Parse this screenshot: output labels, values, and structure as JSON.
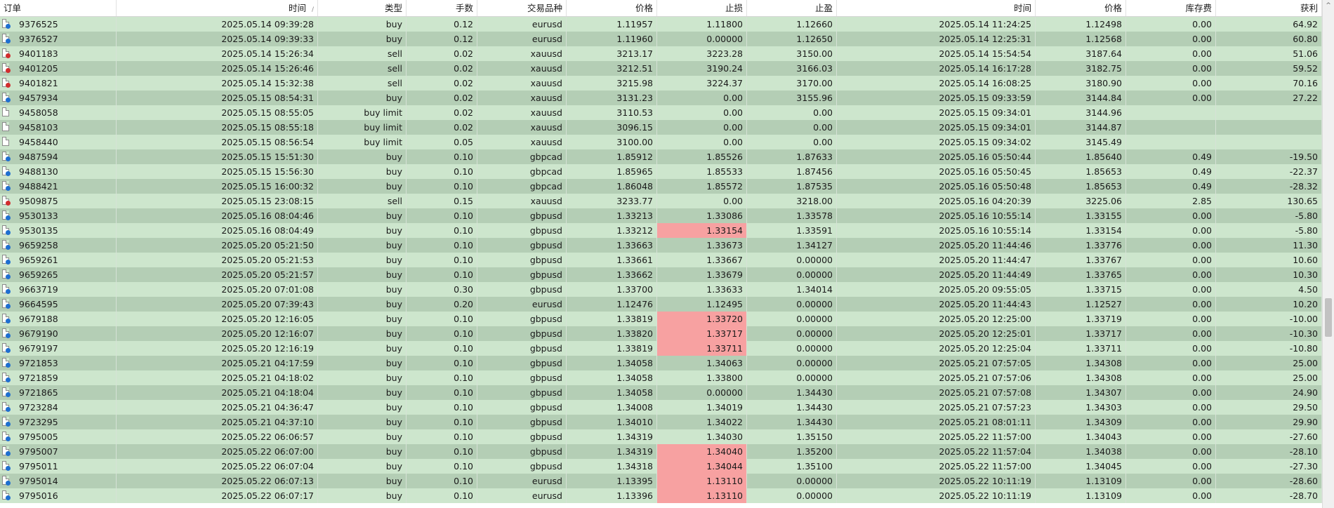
{
  "columns": [
    {
      "key": "order",
      "label": "订单",
      "sort": ""
    },
    {
      "key": "time",
      "label": "时间",
      "sort": "/"
    },
    {
      "key": "type",
      "label": "类型",
      "sort": ""
    },
    {
      "key": "volume",
      "label": "手数",
      "sort": ""
    },
    {
      "key": "symbol",
      "label": "交易品种",
      "sort": ""
    },
    {
      "key": "price",
      "label": "价格",
      "sort": ""
    },
    {
      "key": "sl",
      "label": "止损",
      "sort": ""
    },
    {
      "key": "tp",
      "label": "止盈",
      "sort": ""
    },
    {
      "key": "close_time",
      "label": "时间",
      "sort": ""
    },
    {
      "key": "close_price",
      "label": "价格",
      "sort": ""
    },
    {
      "key": "swap",
      "label": "库存费",
      "sort": ""
    },
    {
      "key": "profit",
      "label": "获利",
      "sort": ""
    }
  ],
  "colors": {
    "row_even": "#cde6cd",
    "row_odd": "#b4ceb5",
    "stop_hit": "#f7a1a1",
    "buy_icon": "#1e6fd0",
    "sell_icon": "#d12d2d"
  },
  "rows": [
    {
      "order": "9376525",
      "time": "2025.05.14 09:39:28",
      "type": "buy",
      "volume": "0.12",
      "symbol": "eurusd",
      "price": "1.11957",
      "sl": "1.11800",
      "tp": "1.12660",
      "close_time": "2025.05.14 11:24:25",
      "close_price": "1.12498",
      "swap": "0.00",
      "profit": "64.92",
      "icon": "buy-order-icon",
      "sl_hit": false
    },
    {
      "order": "9376527",
      "time": "2025.05.14 09:39:33",
      "type": "buy",
      "volume": "0.12",
      "symbol": "eurusd",
      "price": "1.11960",
      "sl": "0.00000",
      "tp": "1.12650",
      "close_time": "2025.05.14 12:25:31",
      "close_price": "1.12568",
      "swap": "0.00",
      "profit": "60.80",
      "icon": "buy-order-icon",
      "sl_hit": false
    },
    {
      "order": "9401183",
      "time": "2025.05.14 15:26:34",
      "type": "sell",
      "volume": "0.02",
      "symbol": "xauusd",
      "price": "3213.17",
      "sl": "3223.28",
      "tp": "3150.00",
      "close_time": "2025.05.14 15:54:54",
      "close_price": "3187.64",
      "swap": "0.00",
      "profit": "51.06",
      "icon": "sell-order-icon",
      "sl_hit": false
    },
    {
      "order": "9401205",
      "time": "2025.05.14 15:26:46",
      "type": "sell",
      "volume": "0.02",
      "symbol": "xauusd",
      "price": "3212.51",
      "sl": "3190.24",
      "tp": "3166.03",
      "close_time": "2025.05.14 16:17:28",
      "close_price": "3182.75",
      "swap": "0.00",
      "profit": "59.52",
      "icon": "sell-order-icon",
      "sl_hit": false
    },
    {
      "order": "9401821",
      "time": "2025.05.14 15:32:38",
      "type": "sell",
      "volume": "0.02",
      "symbol": "xauusd",
      "price": "3215.98",
      "sl": "3224.37",
      "tp": "3170.00",
      "close_time": "2025.05.14 16:08:25",
      "close_price": "3180.90",
      "swap": "0.00",
      "profit": "70.16",
      "icon": "sell-order-icon",
      "sl_hit": false
    },
    {
      "order": "9457934",
      "time": "2025.05.15 08:54:31",
      "type": "buy",
      "volume": "0.02",
      "symbol": "xauusd",
      "price": "3131.23",
      "sl": "0.00",
      "tp": "3155.96",
      "close_time": "2025.05.15 09:33:59",
      "close_price": "3144.84",
      "swap": "0.00",
      "profit": "27.22",
      "icon": "buy-order-icon",
      "sl_hit": false
    },
    {
      "order": "9458058",
      "time": "2025.05.15 08:55:05",
      "type": "buy limit",
      "volume": "0.02",
      "symbol": "xauusd",
      "price": "3110.53",
      "sl": "0.00",
      "tp": "0.00",
      "close_time": "2025.05.15 09:34:01",
      "close_price": "3144.96",
      "swap": "",
      "profit": "",
      "icon": "pending-order-icon",
      "sl_hit": false
    },
    {
      "order": "9458103",
      "time": "2025.05.15 08:55:18",
      "type": "buy limit",
      "volume": "0.02",
      "symbol": "xauusd",
      "price": "3096.15",
      "sl": "0.00",
      "tp": "0.00",
      "close_time": "2025.05.15 09:34:01",
      "close_price": "3144.87",
      "swap": "",
      "profit": "",
      "icon": "pending-order-icon",
      "sl_hit": false
    },
    {
      "order": "9458440",
      "time": "2025.05.15 08:56:54",
      "type": "buy limit",
      "volume": "0.05",
      "symbol": "xauusd",
      "price": "3100.00",
      "sl": "0.00",
      "tp": "0.00",
      "close_time": "2025.05.15 09:34:02",
      "close_price": "3145.49",
      "swap": "",
      "profit": "",
      "icon": "pending-order-icon",
      "sl_hit": false
    },
    {
      "order": "9487594",
      "time": "2025.05.15 15:51:30",
      "type": "buy",
      "volume": "0.10",
      "symbol": "gbpcad",
      "price": "1.85912",
      "sl": "1.85526",
      "tp": "1.87633",
      "close_time": "2025.05.16 05:50:44",
      "close_price": "1.85640",
      "swap": "0.49",
      "profit": "-19.50",
      "icon": "buy-order-icon",
      "sl_hit": false
    },
    {
      "order": "9488130",
      "time": "2025.05.15 15:56:30",
      "type": "buy",
      "volume": "0.10",
      "symbol": "gbpcad",
      "price": "1.85965",
      "sl": "1.85533",
      "tp": "1.87456",
      "close_time": "2025.05.16 05:50:45",
      "close_price": "1.85653",
      "swap": "0.49",
      "profit": "-22.37",
      "icon": "buy-order-icon",
      "sl_hit": false
    },
    {
      "order": "9488421",
      "time": "2025.05.15 16:00:32",
      "type": "buy",
      "volume": "0.10",
      "symbol": "gbpcad",
      "price": "1.86048",
      "sl": "1.85572",
      "tp": "1.87535",
      "close_time": "2025.05.16 05:50:48",
      "close_price": "1.85653",
      "swap": "0.49",
      "profit": "-28.32",
      "icon": "buy-order-icon",
      "sl_hit": false
    },
    {
      "order": "9509875",
      "time": "2025.05.15 23:08:15",
      "type": "sell",
      "volume": "0.15",
      "symbol": "xauusd",
      "price": "3233.77",
      "sl": "0.00",
      "tp": "3218.00",
      "close_time": "2025.05.16 04:20:39",
      "close_price": "3225.06",
      "swap": "2.85",
      "profit": "130.65",
      "icon": "sell-order-icon",
      "sl_hit": false
    },
    {
      "order": "9530133",
      "time": "2025.05.16 08:04:46",
      "type": "buy",
      "volume": "0.10",
      "symbol": "gbpusd",
      "price": "1.33213",
      "sl": "1.33086",
      "tp": "1.33578",
      "close_time": "2025.05.16 10:55:14",
      "close_price": "1.33155",
      "swap": "0.00",
      "profit": "-5.80",
      "icon": "buy-order-icon",
      "sl_hit": false
    },
    {
      "order": "9530135",
      "time": "2025.05.16 08:04:49",
      "type": "buy",
      "volume": "0.10",
      "symbol": "gbpusd",
      "price": "1.33212",
      "sl": "1.33154",
      "tp": "1.33591",
      "close_time": "2025.05.16 10:55:14",
      "close_price": "1.33154",
      "swap": "0.00",
      "profit": "-5.80",
      "icon": "buy-order-icon",
      "sl_hit": true
    },
    {
      "order": "9659258",
      "time": "2025.05.20 05:21:50",
      "type": "buy",
      "volume": "0.10",
      "symbol": "gbpusd",
      "price": "1.33663",
      "sl": "1.33673",
      "tp": "1.34127",
      "close_time": "2025.05.20 11:44:46",
      "close_price": "1.33776",
      "swap": "0.00",
      "profit": "11.30",
      "icon": "buy-order-icon",
      "sl_hit": false
    },
    {
      "order": "9659261",
      "time": "2025.05.20 05:21:53",
      "type": "buy",
      "volume": "0.10",
      "symbol": "gbpusd",
      "price": "1.33661",
      "sl": "1.33667",
      "tp": "0.00000",
      "close_time": "2025.05.20 11:44:47",
      "close_price": "1.33767",
      "swap": "0.00",
      "profit": "10.60",
      "icon": "buy-order-icon",
      "sl_hit": false
    },
    {
      "order": "9659265",
      "time": "2025.05.20 05:21:57",
      "type": "buy",
      "volume": "0.10",
      "symbol": "gbpusd",
      "price": "1.33662",
      "sl": "1.33679",
      "tp": "0.00000",
      "close_time": "2025.05.20 11:44:49",
      "close_price": "1.33765",
      "swap": "0.00",
      "profit": "10.30",
      "icon": "buy-order-icon",
      "sl_hit": false
    },
    {
      "order": "9663719",
      "time": "2025.05.20 07:01:08",
      "type": "buy",
      "volume": "0.30",
      "symbol": "gbpusd",
      "price": "1.33700",
      "sl": "1.33633",
      "tp": "1.34014",
      "close_time": "2025.05.20 09:55:05",
      "close_price": "1.33715",
      "swap": "0.00",
      "profit": "4.50",
      "icon": "buy-order-icon",
      "sl_hit": false
    },
    {
      "order": "9664595",
      "time": "2025.05.20 07:39:43",
      "type": "buy",
      "volume": "0.20",
      "symbol": "eurusd",
      "price": "1.12476",
      "sl": "1.12495",
      "tp": "0.00000",
      "close_time": "2025.05.20 11:44:43",
      "close_price": "1.12527",
      "swap": "0.00",
      "profit": "10.20",
      "icon": "buy-order-icon",
      "sl_hit": false
    },
    {
      "order": "9679188",
      "time": "2025.05.20 12:16:05",
      "type": "buy",
      "volume": "0.10",
      "symbol": "gbpusd",
      "price": "1.33819",
      "sl": "1.33720",
      "tp": "0.00000",
      "close_time": "2025.05.20 12:25:00",
      "close_price": "1.33719",
      "swap": "0.00",
      "profit": "-10.00",
      "icon": "buy-order-icon",
      "sl_hit": true
    },
    {
      "order": "9679190",
      "time": "2025.05.20 12:16:07",
      "type": "buy",
      "volume": "0.10",
      "symbol": "gbpusd",
      "price": "1.33820",
      "sl": "1.33717",
      "tp": "0.00000",
      "close_time": "2025.05.20 12:25:01",
      "close_price": "1.33717",
      "swap": "0.00",
      "profit": "-10.30",
      "icon": "buy-order-icon",
      "sl_hit": true
    },
    {
      "order": "9679197",
      "time": "2025.05.20 12:16:19",
      "type": "buy",
      "volume": "0.10",
      "symbol": "gbpusd",
      "price": "1.33819",
      "sl": "1.33711",
      "tp": "0.00000",
      "close_time": "2025.05.20 12:25:04",
      "close_price": "1.33711",
      "swap": "0.00",
      "profit": "-10.80",
      "icon": "buy-order-icon",
      "sl_hit": true
    },
    {
      "order": "9721853",
      "time": "2025.05.21 04:17:59",
      "type": "buy",
      "volume": "0.10",
      "symbol": "gbpusd",
      "price": "1.34058",
      "sl": "1.34063",
      "tp": "0.00000",
      "close_time": "2025.05.21 07:57:05",
      "close_price": "1.34308",
      "swap": "0.00",
      "profit": "25.00",
      "icon": "buy-order-icon",
      "sl_hit": false
    },
    {
      "order": "9721859",
      "time": "2025.05.21 04:18:02",
      "type": "buy",
      "volume": "0.10",
      "symbol": "gbpusd",
      "price": "1.34058",
      "sl": "1.33800",
      "tp": "0.00000",
      "close_time": "2025.05.21 07:57:06",
      "close_price": "1.34308",
      "swap": "0.00",
      "profit": "25.00",
      "icon": "buy-order-icon",
      "sl_hit": false
    },
    {
      "order": "9721865",
      "time": "2025.05.21 04:18:04",
      "type": "buy",
      "volume": "0.10",
      "symbol": "gbpusd",
      "price": "1.34058",
      "sl": "0.00000",
      "tp": "1.34430",
      "close_time": "2025.05.21 07:57:08",
      "close_price": "1.34307",
      "swap": "0.00",
      "profit": "24.90",
      "icon": "buy-order-icon",
      "sl_hit": false
    },
    {
      "order": "9723284",
      "time": "2025.05.21 04:36:47",
      "type": "buy",
      "volume": "0.10",
      "symbol": "gbpusd",
      "price": "1.34008",
      "sl": "1.34019",
      "tp": "1.34430",
      "close_time": "2025.05.21 07:57:23",
      "close_price": "1.34303",
      "swap": "0.00",
      "profit": "29.50",
      "icon": "buy-order-icon",
      "sl_hit": false
    },
    {
      "order": "9723295",
      "time": "2025.05.21 04:37:10",
      "type": "buy",
      "volume": "0.10",
      "symbol": "gbpusd",
      "price": "1.34010",
      "sl": "1.34022",
      "tp": "1.34430",
      "close_time": "2025.05.21 08:01:11",
      "close_price": "1.34309",
      "swap": "0.00",
      "profit": "29.90",
      "icon": "buy-order-icon",
      "sl_hit": false
    },
    {
      "order": "9795005",
      "time": "2025.05.22 06:06:57",
      "type": "buy",
      "volume": "0.10",
      "symbol": "gbpusd",
      "price": "1.34319",
      "sl": "1.34030",
      "tp": "1.35150",
      "close_time": "2025.05.22 11:57:00",
      "close_price": "1.34043",
      "swap": "0.00",
      "profit": "-27.60",
      "icon": "buy-order-icon",
      "sl_hit": false
    },
    {
      "order": "9795007",
      "time": "2025.05.22 06:07:00",
      "type": "buy",
      "volume": "0.10",
      "symbol": "gbpusd",
      "price": "1.34319",
      "sl": "1.34040",
      "tp": "1.35200",
      "close_time": "2025.05.22 11:57:04",
      "close_price": "1.34038",
      "swap": "0.00",
      "profit": "-28.10",
      "icon": "buy-order-icon",
      "sl_hit": true
    },
    {
      "order": "9795011",
      "time": "2025.05.22 06:07:04",
      "type": "buy",
      "volume": "0.10",
      "symbol": "gbpusd",
      "price": "1.34318",
      "sl": "1.34044",
      "tp": "1.35100",
      "close_time": "2025.05.22 11:57:00",
      "close_price": "1.34045",
      "swap": "0.00",
      "profit": "-27.30",
      "icon": "buy-order-icon",
      "sl_hit": true
    },
    {
      "order": "9795014",
      "time": "2025.05.22 06:07:13",
      "type": "buy",
      "volume": "0.10",
      "symbol": "eurusd",
      "price": "1.13395",
      "sl": "1.13110",
      "tp": "0.00000",
      "close_time": "2025.05.22 10:11:19",
      "close_price": "1.13109",
      "swap": "0.00",
      "profit": "-28.60",
      "icon": "buy-order-icon",
      "sl_hit": true
    },
    {
      "order": "9795016",
      "time": "2025.05.22 06:07:17",
      "type": "buy",
      "volume": "0.10",
      "symbol": "eurusd",
      "price": "1.13396",
      "sl": "1.13110",
      "tp": "0.00000",
      "close_time": "2025.05.22 10:11:19",
      "close_price": "1.13109",
      "swap": "0.00",
      "profit": "-28.70",
      "icon": "buy-order-icon",
      "sl_hit": true
    }
  ],
  "scrollbar": {
    "up_arrow": "^"
  }
}
